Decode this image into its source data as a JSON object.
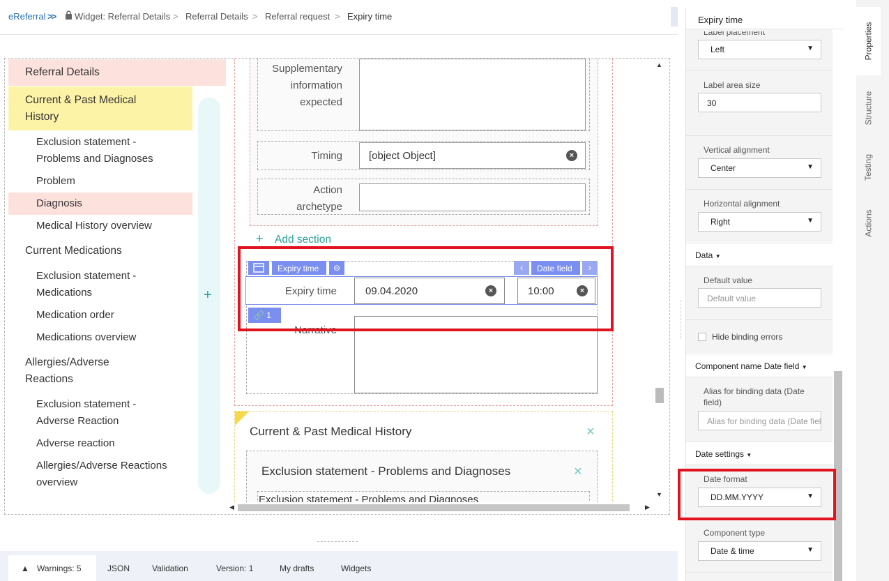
{
  "breadcrumb": {
    "root": "eReferral",
    "items": [
      "Widget: Referral Details",
      "Referral Details",
      "Referral request",
      "Expiry time"
    ]
  },
  "nav": {
    "items": [
      {
        "label": "Referral Details",
        "kind": "section"
      },
      {
        "label": "Current & Past Medical History",
        "kind": "section"
      },
      {
        "label": "Exclusion statement - Problems and Diagnoses",
        "kind": "sub"
      },
      {
        "label": "Problem",
        "kind": "sub"
      },
      {
        "label": "Diagnosis",
        "kind": "sub"
      },
      {
        "label": "Medical History overview",
        "kind": "sub"
      },
      {
        "label": "Current Medications",
        "kind": "section"
      },
      {
        "label": "Exclusion statement - Medications",
        "kind": "sub"
      },
      {
        "label": "Medication order",
        "kind": "sub"
      },
      {
        "label": "Medications overview",
        "kind": "sub"
      },
      {
        "label": "Allergies/Adverse Reactions",
        "kind": "section"
      },
      {
        "label": "Exclusion statement - Adverse Reaction",
        "kind": "sub"
      },
      {
        "label": "Adverse reaction",
        "kind": "sub"
      },
      {
        "label": "Allergies/Adverse Reactions overview",
        "kind": "sub"
      }
    ],
    "add_symbol": "+"
  },
  "form": {
    "supplementary_label": "Supplementary information expected",
    "timing_label": "Timing",
    "timing_value": "[object Object]",
    "action_label": "Action archetype",
    "add_section": "Add section",
    "widget_tag_1": "Expiry time",
    "widget_tag_2": "Date field",
    "expiry_label": "Expiry time",
    "date_value": "09.04.2020",
    "time_value": "10:00",
    "link_count": "1",
    "narrative_label": "Narrative",
    "container_title": "Current & Past Medical History",
    "inner_title": "Exclusion statement - Problems and Diagnoses",
    "inner_sub": "Exclusion statement - Problems and Diagnoses"
  },
  "panel": {
    "title": "Expiry time",
    "label_placement_label": "Label placement",
    "label_placement_value": "Left",
    "label_area_label": "Label area size",
    "label_area_value": "30",
    "vertical_label": "Vertical alignment",
    "vertical_value": "Center",
    "horizontal_label": "Horizontal alignment",
    "horizontal_value": "Right",
    "data_header": "Data",
    "default_label": "Default value",
    "default_placeholder": "Default value",
    "hide_binding": "Hide binding errors",
    "component_header": "Component name Date field",
    "alias_label": "Alias for binding data (Date field)",
    "alias_placeholder": "Alias for binding data (Date field)",
    "date_settings_header": "Date settings",
    "date_format_label": "Date format",
    "date_format_value": "DD.MM.YYYY",
    "component_type_label": "Component type",
    "component_type_value": "Date & time"
  },
  "side_tabs": [
    "Properties",
    "Structure",
    "Testing",
    "Actions"
  ],
  "bottom_tabs": {
    "warnings": "Warnings: 5",
    "items": [
      "JSON",
      "Validation",
      "Version: 1",
      "My drafts",
      "Widgets"
    ]
  },
  "colors": {
    "accent_teal": "#2aa198",
    "widget_blue": "#7b8ff0",
    "highlight_red": "#e0131f",
    "nav_pink": "#fde1dc",
    "nav_yellow": "#fdf3a6"
  }
}
